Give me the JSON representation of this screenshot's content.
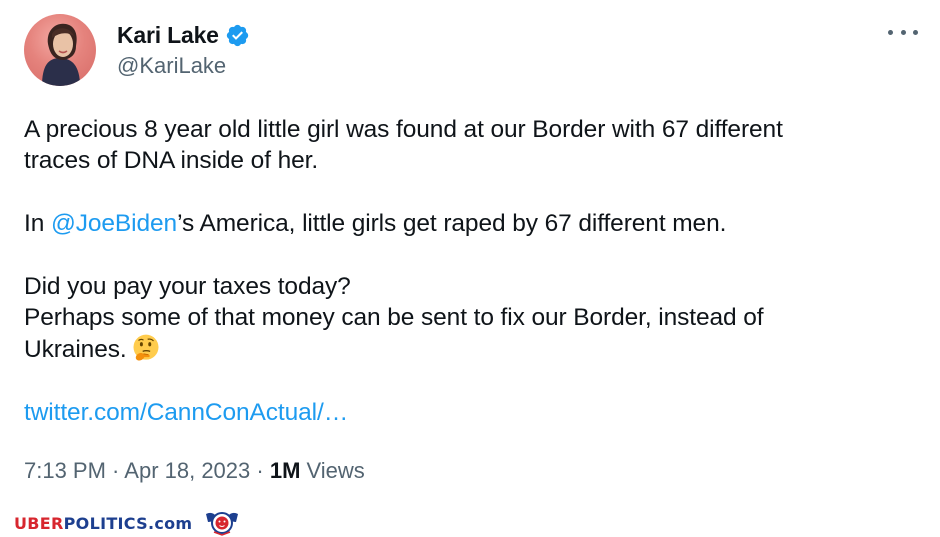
{
  "tweet": {
    "author": {
      "display_name": "Kari Lake",
      "handle": "@KariLake",
      "verified": true,
      "avatar_icon": "profile-photo"
    },
    "more_icon": "more-horizontal-icon",
    "text": {
      "para1_line1": "A precious 8 year old little girl was found at our Border with 67 different",
      "para1_line2": "traces of DNA inside of her.",
      "para2_prefix": "In ",
      "para2_mention": "@JoeBiden",
      "para2_suffix": "’s America, little girls get raped by 67 different men.",
      "para3_line1": "Did you pay your taxes today?",
      "para3_line2": "Perhaps some of that money can be sent to fix our Border, instead of",
      "para3_line3": "Ukraines.",
      "emoji": "thinking-face",
      "link": "twitter.com/CannConActual/…"
    },
    "meta": {
      "time": "7:13 PM",
      "separator": " · ",
      "date": "Apr 18, 2023",
      "views_count": "1M",
      "views_label": " Views"
    }
  },
  "watermark": {
    "part1": "UBER",
    "part2": "POLITICS",
    "part3": ".com",
    "logo_icon": "lion-crest-icon"
  },
  "colors": {
    "link": "#1d9bf0",
    "verified_badge": "#1d9bf0",
    "text_primary": "#0f1419",
    "text_secondary": "#536471",
    "watermark_red": "#d7262e",
    "watermark_blue": "#1d3f8f"
  }
}
